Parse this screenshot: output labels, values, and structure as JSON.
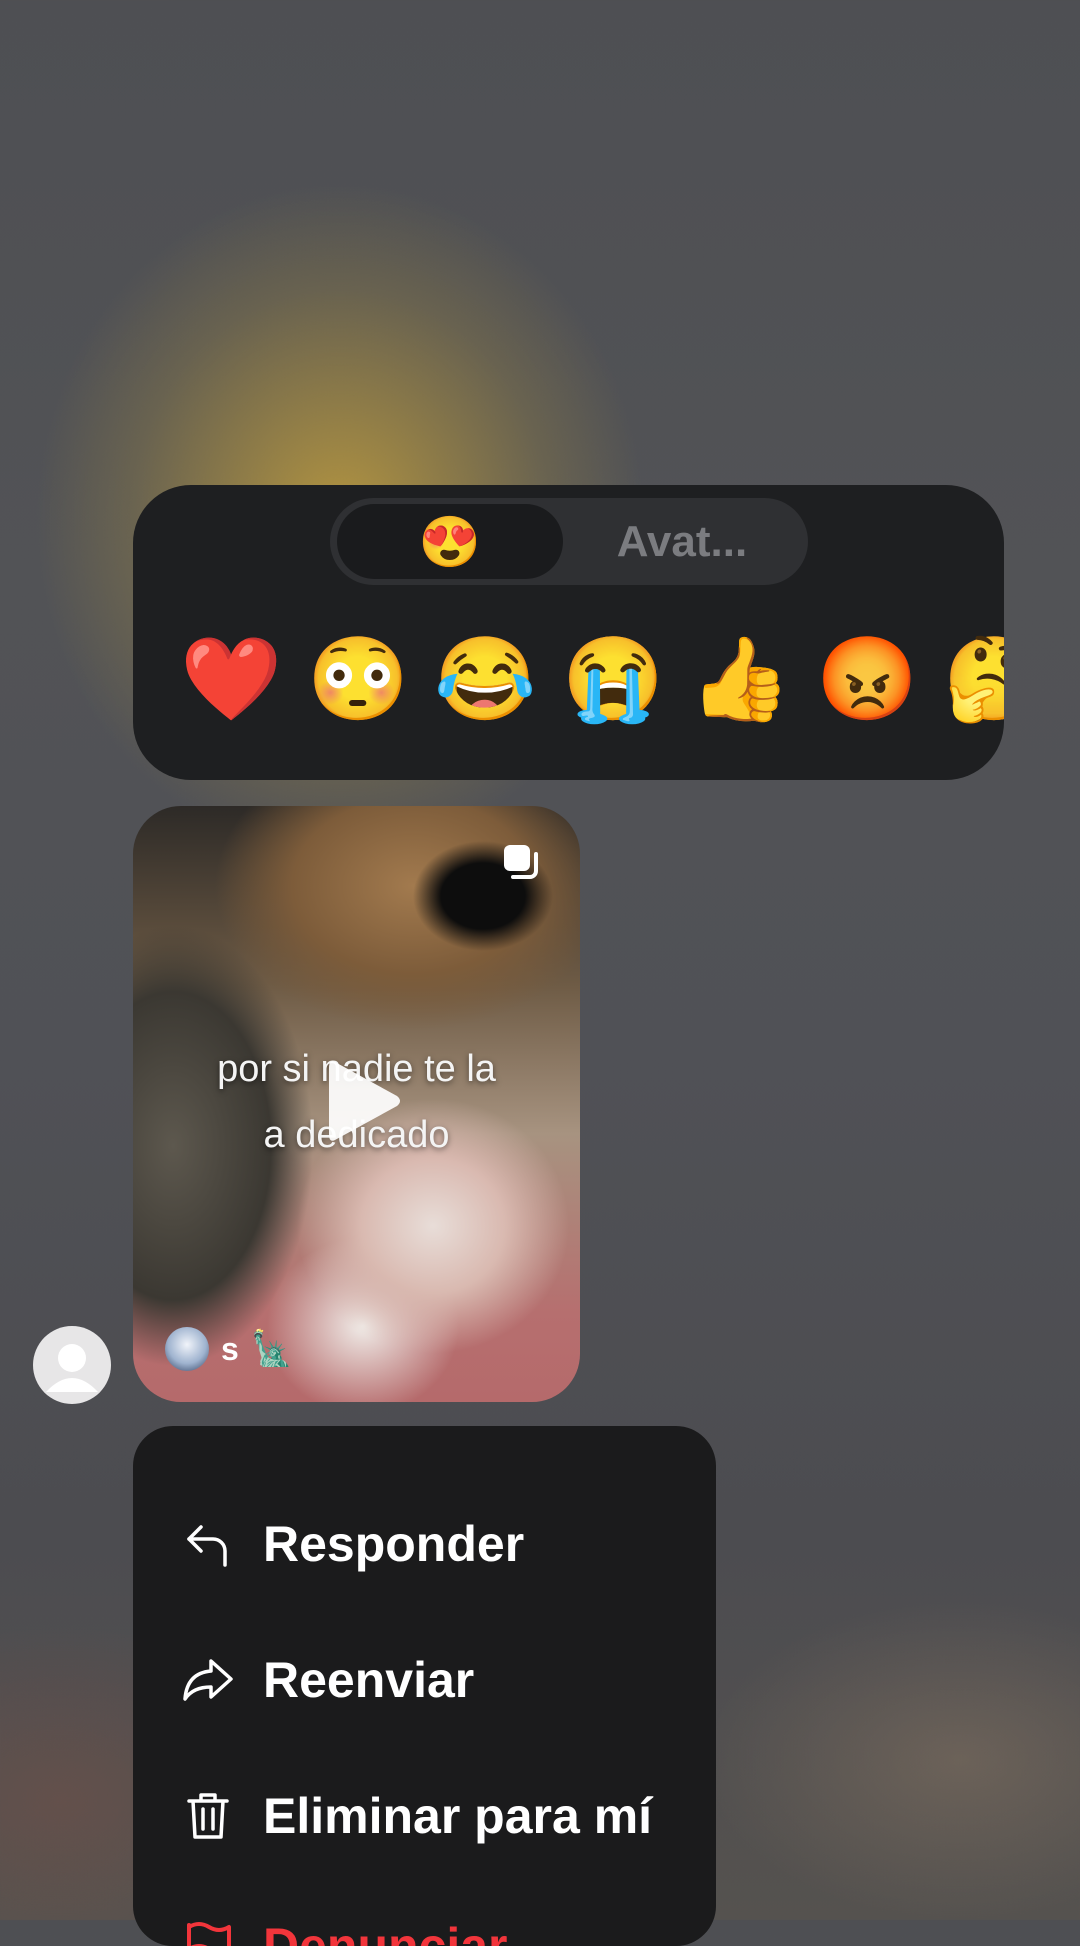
{
  "reaction_picker": {
    "tabs": {
      "emoji_tab": "😍",
      "avatar_tab": "Avat..."
    },
    "emojis": [
      {
        "char": "❤️",
        "name": "red-heart"
      },
      {
        "char": "😳",
        "name": "flushed-face"
      },
      {
        "char": "😂",
        "name": "tears-of-joy"
      },
      {
        "char": "😭",
        "name": "loudly-crying"
      },
      {
        "char": "👍",
        "name": "thumbs-up"
      },
      {
        "char": "😡",
        "name": "angry-face"
      },
      {
        "char": "🤔",
        "name": "thinking-face"
      }
    ]
  },
  "shared_video": {
    "caption_line1": "por si nadie te la",
    "caption_line2": "a dedicado",
    "author_name": "s",
    "author_badge": "🗽",
    "icons": [
      "collection-icon",
      "play-icon"
    ]
  },
  "context_menu": {
    "items": [
      {
        "label": "Responder",
        "icon": "reply-icon"
      },
      {
        "label": "Reenviar",
        "icon": "forward-icon"
      },
      {
        "label": "Eliminar para mí",
        "icon": "trash-icon"
      },
      {
        "label": "Denunciar",
        "icon": "flag-icon",
        "color": "#f2353b"
      }
    ]
  },
  "colors": {
    "panel": "#1e1f21",
    "menu": "#1b1b1c",
    "danger": "#f2353b"
  }
}
